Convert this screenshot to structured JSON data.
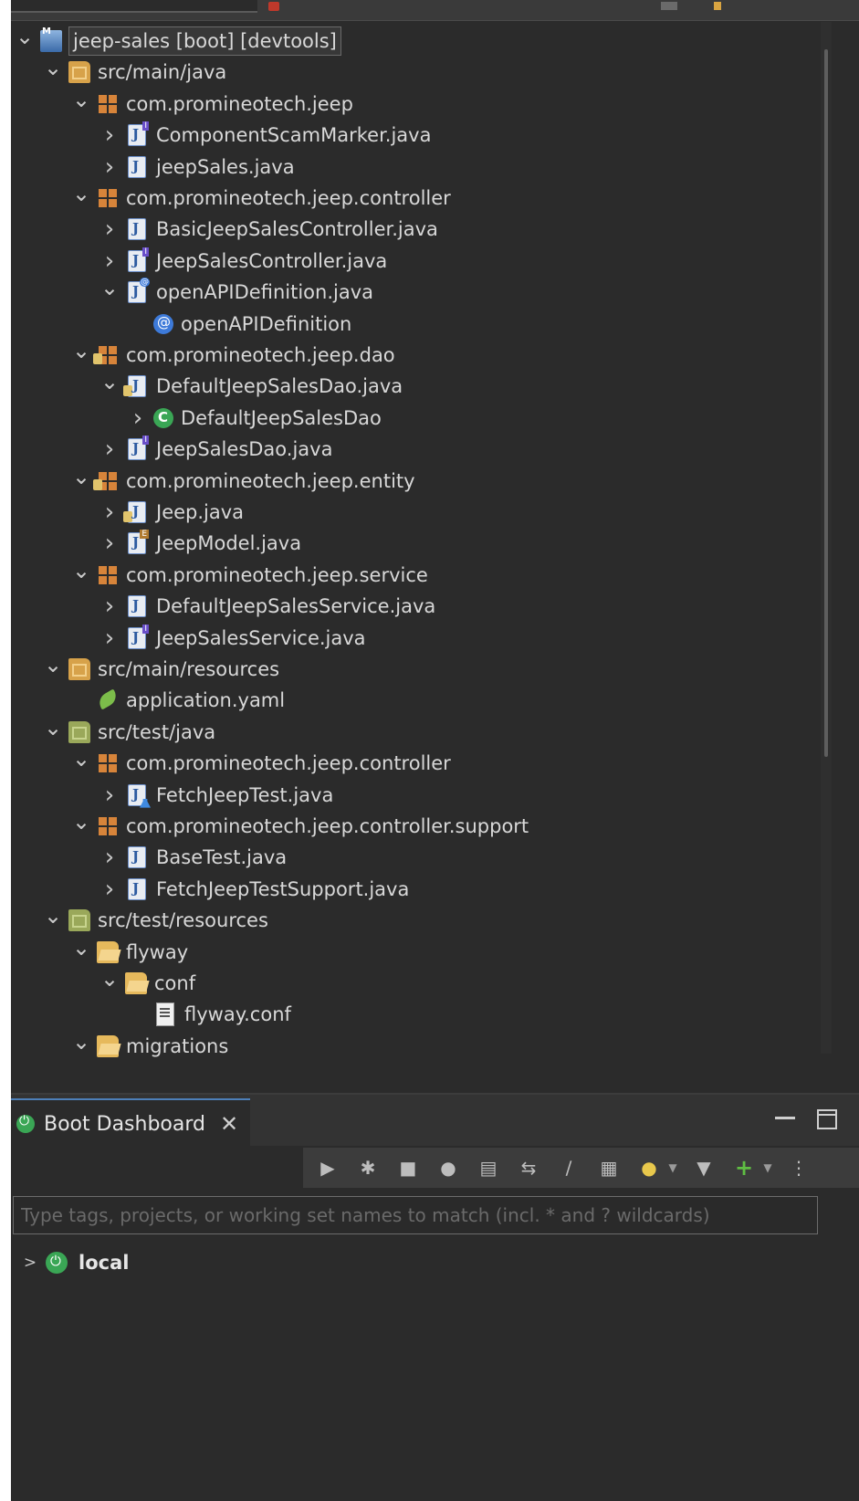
{
  "tree": [
    {
      "label": "jeep-sales [boot] [devtools]",
      "indent": 0,
      "twisty": "open",
      "icon": "project-icon",
      "selected": true
    },
    {
      "label": "src/main/java",
      "indent": 1,
      "twisty": "open",
      "icon": "source-folder-icon"
    },
    {
      "label": "com.promineotech.jeep",
      "indent": 2,
      "twisty": "open",
      "icon": "package-icon"
    },
    {
      "label": "ComponentScamMarker.java",
      "indent": 3,
      "twisty": "closed",
      "icon": "java-interface-icon"
    },
    {
      "label": "jeepSales.java",
      "indent": 3,
      "twisty": "closed",
      "icon": "java-file-icon"
    },
    {
      "label": "com.promineotech.jeep.controller",
      "indent": 2,
      "twisty": "open",
      "icon": "package-icon"
    },
    {
      "label": "BasicJeepSalesController.java",
      "indent": 3,
      "twisty": "closed",
      "icon": "java-file-icon"
    },
    {
      "label": "JeepSalesController.java",
      "indent": 3,
      "twisty": "closed",
      "icon": "java-interface-icon"
    },
    {
      "label": "openAPIDefinition.java",
      "indent": 3,
      "twisty": "open",
      "icon": "java-annotation-icon"
    },
    {
      "label": "openAPIDefinition",
      "indent": 4,
      "twisty": "none",
      "icon": "annotation-icon"
    },
    {
      "label": "com.promineotech.jeep.dao",
      "indent": 2,
      "twisty": "open",
      "icon": "package-locked-icon"
    },
    {
      "label": "DefaultJeepSalesDao.java",
      "indent": 3,
      "twisty": "open",
      "icon": "java-locked-icon"
    },
    {
      "label": "DefaultJeepSalesDao",
      "indent": 4,
      "twisty": "closed",
      "icon": "class-icon"
    },
    {
      "label": "JeepSalesDao.java",
      "indent": 3,
      "twisty": "closed",
      "icon": "java-interface-icon"
    },
    {
      "label": "com.promineotech.jeep.entity",
      "indent": 2,
      "twisty": "open",
      "icon": "package-locked-icon"
    },
    {
      "label": "Jeep.java",
      "indent": 3,
      "twisty": "closed",
      "icon": "java-locked-icon"
    },
    {
      "label": "JeepModel.java",
      "indent": 3,
      "twisty": "closed",
      "icon": "java-enum-icon"
    },
    {
      "label": "com.promineotech.jeep.service",
      "indent": 2,
      "twisty": "open",
      "icon": "package-icon"
    },
    {
      "label": "DefaultJeepSalesService.java",
      "indent": 3,
      "twisty": "closed",
      "icon": "java-file-icon"
    },
    {
      "label": "JeepSalesService.java",
      "indent": 3,
      "twisty": "closed",
      "icon": "java-interface-icon"
    },
    {
      "label": "src/main/resources",
      "indent": 1,
      "twisty": "open",
      "icon": "source-folder-icon"
    },
    {
      "label": "application.yaml",
      "indent": 2,
      "twisty": "none",
      "icon": "spring-leaf-icon"
    },
    {
      "label": "src/test/java",
      "indent": 1,
      "twisty": "open",
      "icon": "test-folder-icon"
    },
    {
      "label": "com.promineotech.jeep.controller",
      "indent": 2,
      "twisty": "open",
      "icon": "package-icon"
    },
    {
      "label": "FetchJeepTest.java",
      "indent": 3,
      "twisty": "closed",
      "icon": "java-test-icon"
    },
    {
      "label": "com.promineotech.jeep.controller.support",
      "indent": 2,
      "twisty": "open",
      "icon": "package-icon"
    },
    {
      "label": "BaseTest.java",
      "indent": 3,
      "twisty": "closed",
      "icon": "java-file-icon"
    },
    {
      "label": "FetchJeepTestSupport.java",
      "indent": 3,
      "twisty": "closed",
      "icon": "java-file-icon"
    },
    {
      "label": "src/test/resources",
      "indent": 1,
      "twisty": "open",
      "icon": "test-folder-icon"
    },
    {
      "label": "flyway",
      "indent": 2,
      "twisty": "open",
      "icon": "folder-open-icon"
    },
    {
      "label": "conf",
      "indent": 3,
      "twisty": "open",
      "icon": "folder-open-icon"
    },
    {
      "label": "flyway.conf",
      "indent": 4,
      "twisty": "none",
      "icon": "text-file-icon"
    },
    {
      "label": "migrations",
      "indent": 2,
      "twisty": "open",
      "icon": "folder-open-icon"
    }
  ],
  "dashboard": {
    "tab_title": "Boot Dashboard",
    "close_glyph": "✕",
    "filter_placeholder": "Type tags, projects, or working set names to match (incl. * and ? wildcards)",
    "local_label": "local",
    "toolbar_icons": [
      "restart-icon",
      "debug-restart-icon",
      "stop-icon",
      "open-browser-icon",
      "console-icon",
      "navigate-icon",
      "edit-icon",
      "properties-icon",
      "bulb-icon",
      "bulb-menu-icon",
      "filter-icon",
      "add-icon",
      "add-menu-icon",
      "more-icon"
    ]
  },
  "colors": {
    "background": "#2b2b2b",
    "text": "#d8d8d8",
    "accent": "#3aa655"
  }
}
